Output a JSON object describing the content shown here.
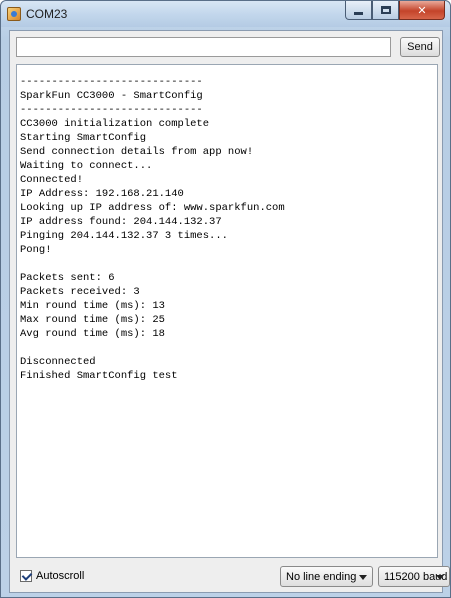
{
  "window": {
    "title": "COM23"
  },
  "send": {
    "input_value": "",
    "button_label": "Send"
  },
  "console": {
    "lines": [
      "-----------------------------",
      "SparkFun CC3000 - SmartConfig",
      "-----------------------------",
      "CC3000 initialization complete",
      "Starting SmartConfig",
      "Send connection details from app now!",
      "Waiting to connect...",
      "Connected!",
      "IP Address: 192.168.21.140",
      "Looking up IP address of: www.sparkfun.com",
      "IP address found: 204.144.132.37",
      "Pinging 204.144.132.37 3 times...",
      "Pong!",
      "",
      "Packets sent: 6",
      "Packets received: 3",
      "Min round time (ms): 13",
      "Max round time (ms): 25",
      "Avg round time (ms): 18",
      "",
      "Disconnected",
      "Finished SmartConfig test"
    ]
  },
  "status": {
    "autoscroll_label": "Autoscroll",
    "autoscroll_checked": true,
    "line_ending": "No line ending",
    "baud": "115200 baud"
  },
  "icons": {
    "app": "java-app-icon",
    "minimize": "minimize-icon",
    "maximize": "maximize-icon",
    "close": "close-icon"
  }
}
